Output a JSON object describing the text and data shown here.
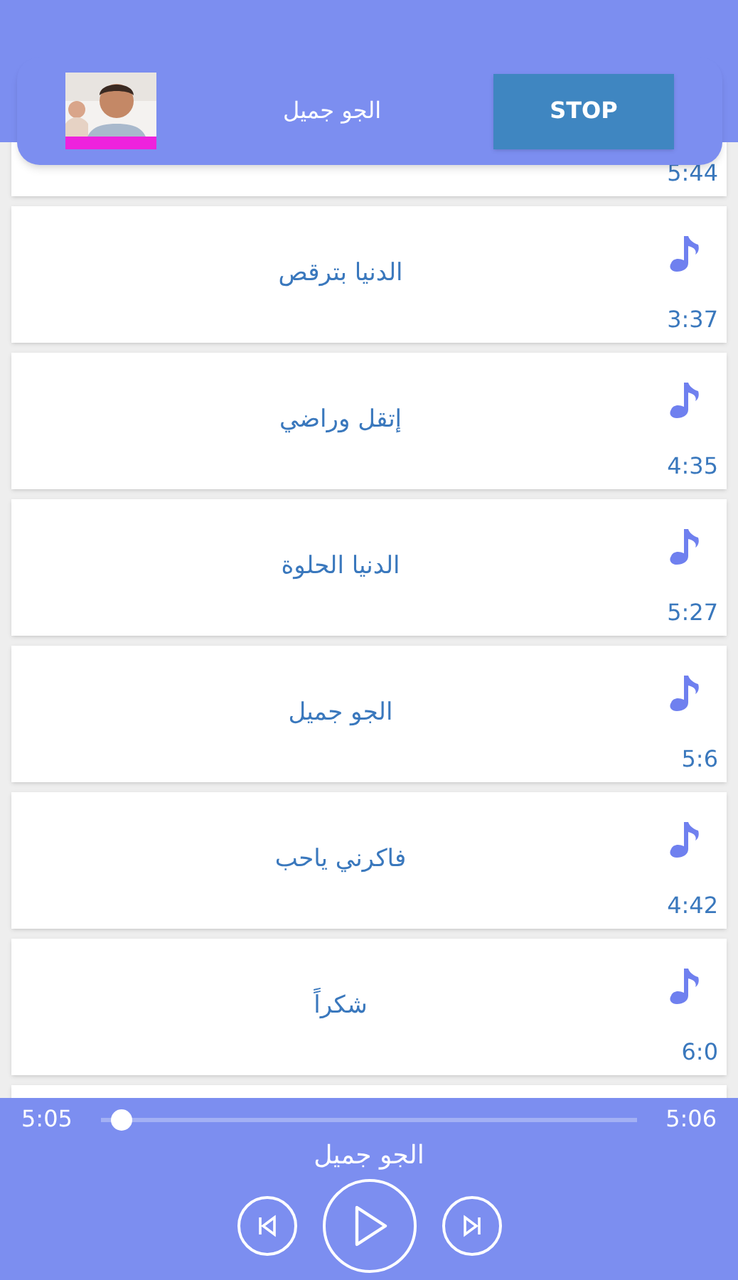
{
  "now_playing_banner": {
    "title": "الجو جميل",
    "button": "STOP"
  },
  "songs": [
    {
      "duration": "5:44"
    },
    {
      "title": "الدنيا بترقص",
      "duration": "3:37"
    },
    {
      "title": "إتقل وراضي",
      "duration": "4:35"
    },
    {
      "title": "الدنيا الحلوة",
      "duration": "5:27"
    },
    {
      "title": "الجو جميل",
      "duration": "5:6"
    },
    {
      "title": "فاكرني ياحب",
      "duration": "4:42"
    },
    {
      "title": "شكراً",
      "duration": "6:0"
    }
  ],
  "player": {
    "elapsed": "5:05",
    "total": "5:06",
    "level": 0.02,
    "title": "الجو جميل",
    "controls": [
      {
        "kind": "previous"
      },
      {
        "kind": "play"
      },
      {
        "kind": "next"
      }
    ]
  }
}
